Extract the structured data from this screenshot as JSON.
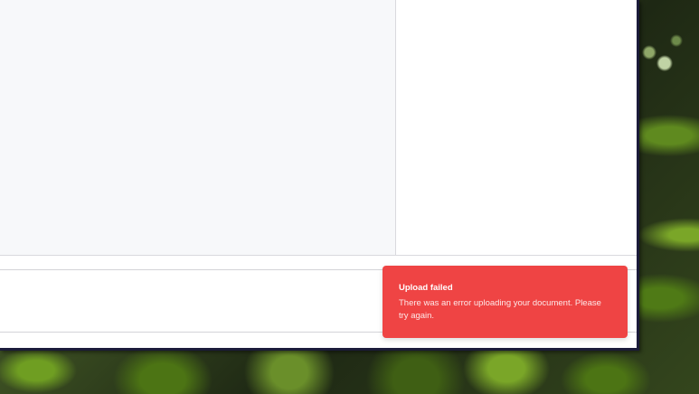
{
  "toast": {
    "title": "Upload failed",
    "message": "There was an error uploading your document. Please try again.",
    "background_color": "#ef4444"
  }
}
